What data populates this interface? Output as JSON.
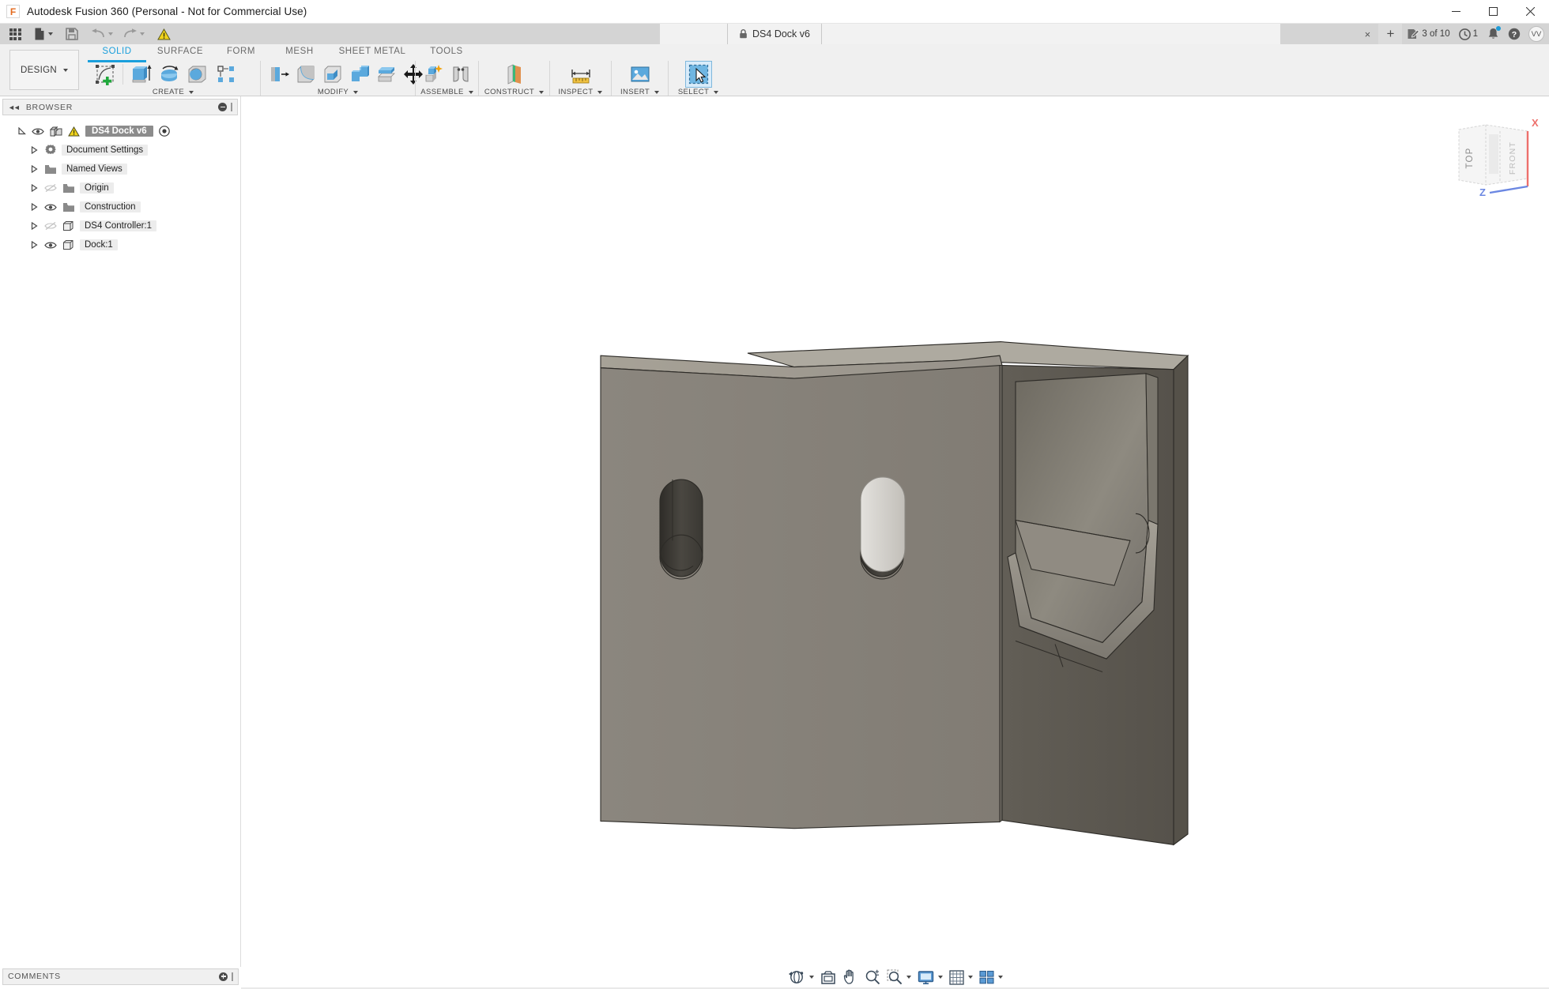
{
  "window": {
    "title": "Autodesk Fusion 360 (Personal - Not for Commercial Use)",
    "logo_letter": "F",
    "minimize_name": "minimize-icon",
    "maximize_name": "maximize-icon",
    "close_name": "close-icon"
  },
  "quick_access": {
    "items": [
      {
        "name": "app-grid-icon",
        "label": ""
      },
      {
        "name": "new-file-icon",
        "label": ""
      },
      {
        "name": "save-icon",
        "label": ""
      },
      {
        "name": "undo-icon",
        "label": ""
      },
      {
        "name": "redo-icon",
        "label": ""
      },
      {
        "name": "warning-icon",
        "label": ""
      }
    ],
    "document_tab": {
      "label": "DS4 Dock v6",
      "lock_icon": "lock-icon"
    },
    "close_tab_glyph": "×",
    "new_tab_glyph": "+",
    "jobs_status": "3 of 10",
    "history_count": "1",
    "avatar_initials": "VV"
  },
  "ribbon": {
    "workspace": "DESIGN",
    "tabs": [
      {
        "label": "SOLID",
        "active": true
      },
      {
        "label": "SURFACE",
        "active": false
      },
      {
        "label": "FORM",
        "active": false
      },
      {
        "label": "MESH",
        "active": false
      },
      {
        "label": "SHEET METAL",
        "active": false
      },
      {
        "label": "TOOLS",
        "active": false
      }
    ],
    "panels": [
      {
        "label": "CREATE"
      },
      {
        "label": "MODIFY"
      },
      {
        "label": "ASSEMBLE"
      },
      {
        "label": "CONSTRUCT"
      },
      {
        "label": "INSPECT"
      },
      {
        "label": "INSERT"
      },
      {
        "label": "SELECT"
      }
    ]
  },
  "browser": {
    "title": "BROWSER",
    "items": [
      {
        "label": "DS4 Dock v6",
        "icon": "component-icon",
        "visible": true,
        "warning": true,
        "root": true,
        "expanded": true,
        "radio": true
      },
      {
        "label": "Document Settings",
        "icon": "gear-icon",
        "visible": null,
        "indent": 1
      },
      {
        "label": "Named Views",
        "icon": "folder-icon",
        "visible": null,
        "indent": 1
      },
      {
        "label": "Origin",
        "icon": "folder-icon",
        "visible": false,
        "indent": 1
      },
      {
        "label": "Construction",
        "icon": "folder-icon",
        "visible": true,
        "indent": 1
      },
      {
        "label": "DS4 Controller:1",
        "icon": "body-icon",
        "visible": false,
        "indent": 1
      },
      {
        "label": "Dock:1",
        "icon": "body-icon",
        "visible": true,
        "indent": 1
      }
    ]
  },
  "viewcube": {
    "top_face": "TOP",
    "front_face": "FRONT",
    "axis_x": "X",
    "axis_z": "Z",
    "axis_x_color": "#e8413c",
    "axis_z_color": "#3a5fd9"
  },
  "comments": {
    "title": "COMMENTS"
  },
  "navbar": {
    "items": [
      {
        "name": "orbit-icon",
        "has_caret": true
      },
      {
        "name": "look-at-icon",
        "has_caret": false
      },
      {
        "name": "pan-icon",
        "has_caret": false
      },
      {
        "name": "zoom-icon",
        "has_caret": false
      },
      {
        "name": "zoom-window-icon",
        "has_caret": true
      },
      {
        "name": "display-settings-icon",
        "has_caret": true
      },
      {
        "name": "grid-snap-icon",
        "has_caret": true
      },
      {
        "name": "viewports-icon",
        "has_caret": true
      }
    ]
  },
  "model": {
    "name": "ds4-dock-3d-model",
    "colors": {
      "face_front": "#87827a",
      "face_right": "#5b574f",
      "face_top": "#a39e93",
      "cavity_light": "#9a9589",
      "cavity_dark": "#6d685f",
      "slot_dark": "#3c3934",
      "highlight": "#cfccc6",
      "edge": "#2d2b27"
    }
  }
}
